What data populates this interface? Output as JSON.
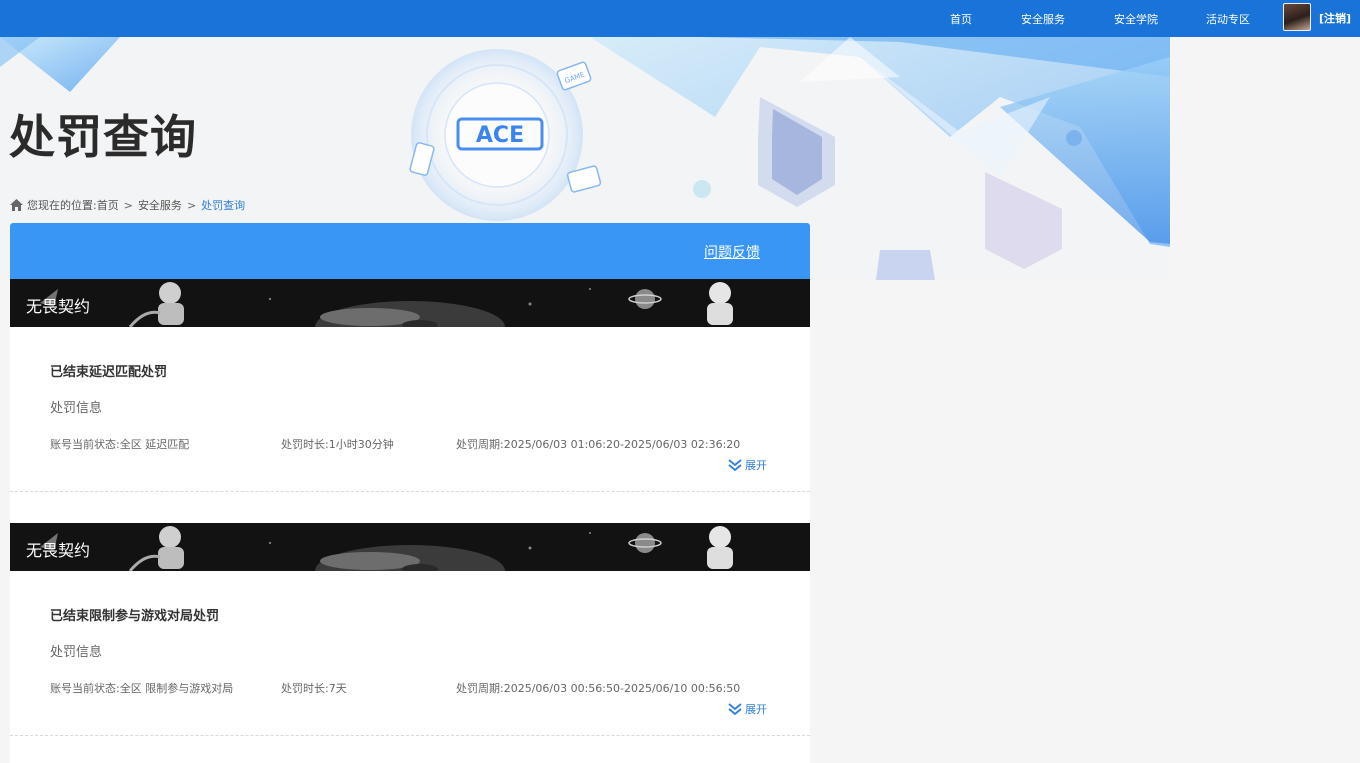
{
  "nav": {
    "links": [
      "首页",
      "安全服务",
      "安全学院",
      "活动专区"
    ],
    "logout": "[注销]"
  },
  "banner": {
    "logo_text": "ACE",
    "game_badge": "GAME"
  },
  "page": {
    "title": "处罚查询"
  },
  "breadcrumb": {
    "prefix": "您现在的位置:",
    "items": [
      "首页",
      "安全服务",
      "处罚查询"
    ],
    "separator": ">"
  },
  "panel": {
    "feedback": "问题反馈"
  },
  "records": [
    {
      "banner_title": "无畏契约",
      "title": "已结束延迟匹配处罚",
      "subtitle": "处罚信息",
      "status": "账号当前状态:全区 延迟匹配",
      "duration": "处罚时长:1小时30分钟",
      "period": "处罚周期:2025/06/03 01:06:20-2025/06/03 02:36:20",
      "expand": "展开"
    },
    {
      "banner_title": "无畏契约",
      "title": "已结束限制参与游戏对局处罚",
      "subtitle": "处罚信息",
      "status": "账号当前状态:全区 限制参与游戏对局",
      "duration": "处罚时长:7天",
      "period": "处罚周期:2025/06/03 00:56:50-2025/06/10 00:56:50",
      "expand": "展开"
    }
  ],
  "colors": {
    "topbar": "#1a73d9",
    "panel_header": "#3a96f5",
    "link": "#2f7fd8"
  }
}
